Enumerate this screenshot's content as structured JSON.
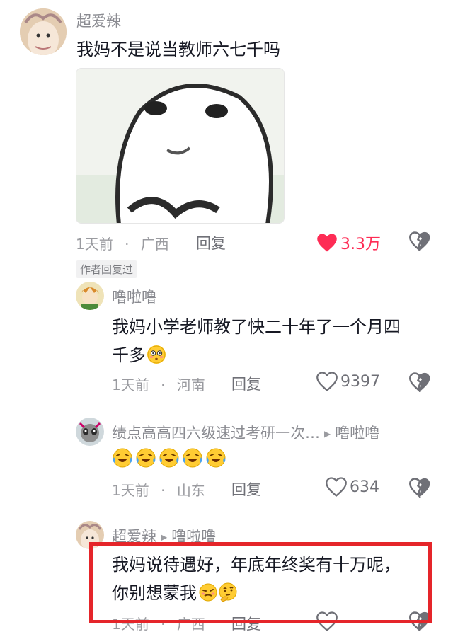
{
  "comments": [
    {
      "username": "超爱辣",
      "text": "我妈不是说当教师六七千吗",
      "time": "1天前",
      "region": "广西",
      "reply_label": "回复",
      "likes": "3.3万",
      "liked": true,
      "author_badge": "作者回复过"
    },
    {
      "username": "噜啦噜",
      "text_line1": "我妈小学老师教了快二十年了一个月四",
      "text_line2": "千多",
      "time": "1天前",
      "region": "河南",
      "reply_label": "回复",
      "likes": "9397"
    },
    {
      "username": "绩点高高四六级速过考研一次…",
      "reply_to": "噜啦噜",
      "time": "1天前",
      "region": "山东",
      "reply_label": "回复",
      "likes": "634"
    },
    {
      "username": "超爱辣",
      "reply_to": "噜啦噜",
      "text_line1": "我妈说待遇好，年底年终奖有十万呢，",
      "text_line2": "你别想蒙我",
      "time": "1天前",
      "region": "广西",
      "reply_label": "回复"
    }
  ],
  "separator": "·",
  "colors": {
    "liked_red": "#fe2c55",
    "highlight_box": "#e5252a",
    "meta_gray": "#9a9ba0"
  },
  "icons": [
    "heart-icon",
    "broken-heart-icon",
    "emoji-icon",
    "reply-arrow-icon"
  ]
}
